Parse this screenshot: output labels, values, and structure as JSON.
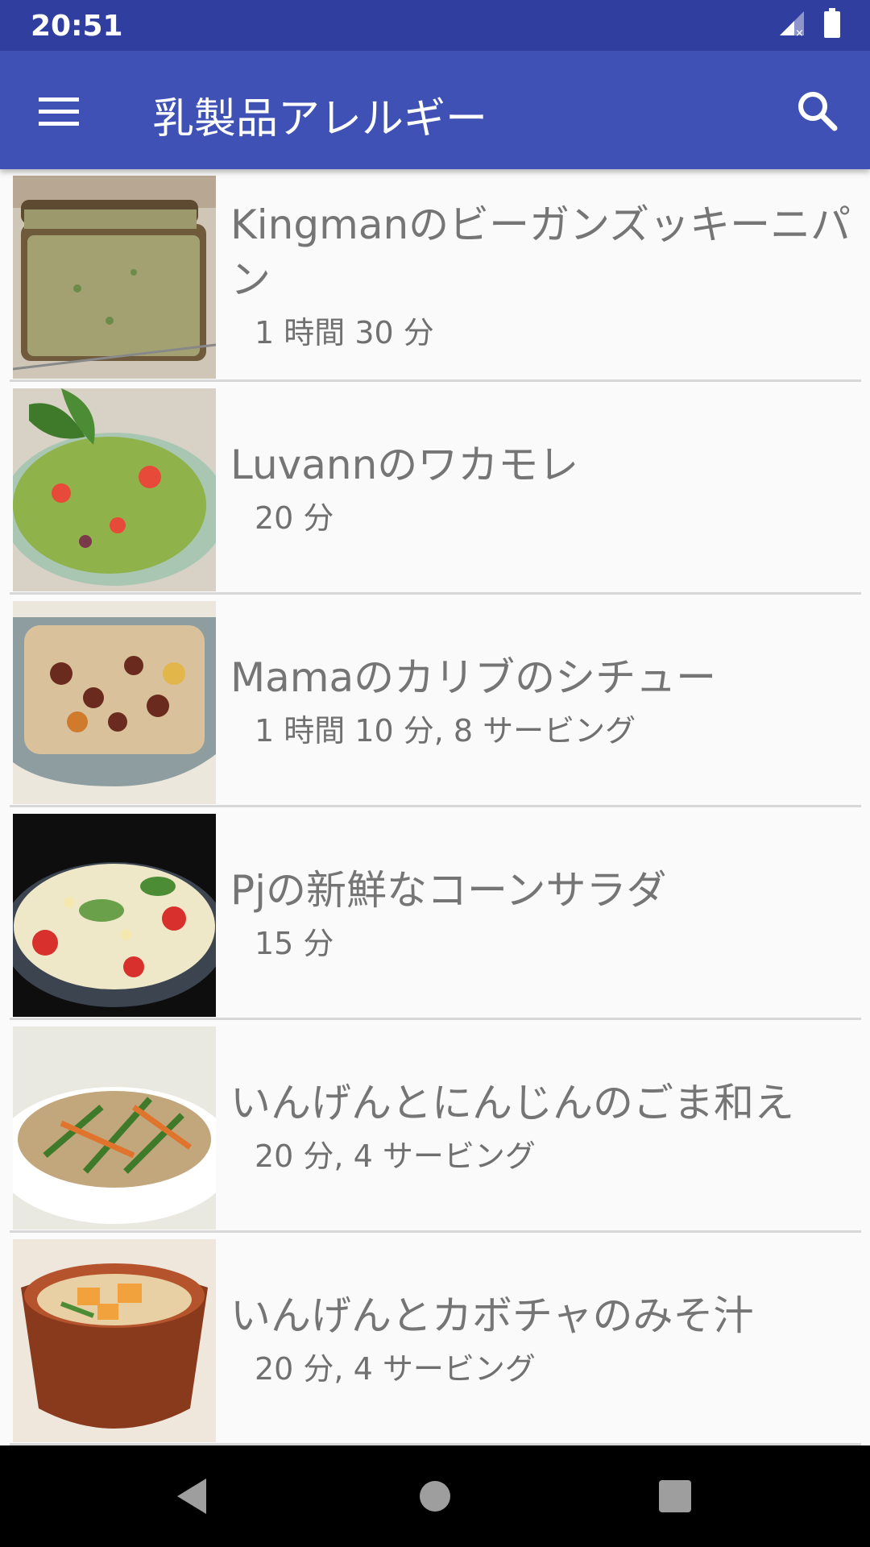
{
  "status_bar": {
    "time": "20:51",
    "icons": [
      "signal-icon",
      "battery-icon"
    ]
  },
  "app_bar": {
    "title": "乳製品アレルギー",
    "menu_icon": "menu-icon",
    "search_icon": "search-icon"
  },
  "recipes": [
    {
      "title": "Kingmanのビーガンズッキーニパン",
      "meta": "1 時間 30 分",
      "image": "zucchini-bread"
    },
    {
      "title": "Luvannのワカモレ",
      "meta": "20 分",
      "image": "guacamole"
    },
    {
      "title": "Mamaのカリブのシチュー",
      "meta": "1 時間 10 分, 8 サービング",
      "image": "caribbean-stew"
    },
    {
      "title": "Pjの新鮮なコーンサラダ",
      "meta": "15 分",
      "image": "corn-salad"
    },
    {
      "title": "いんげんとにんじんのごま和え",
      "meta": "20 分, 4 サービング",
      "image": "green-beans-carrot"
    },
    {
      "title": "いんげんとカボチャのみそ汁",
      "meta": "20 分, 4 サービング",
      "image": "miso-soup"
    }
  ],
  "nav_bar": {
    "back": "back-icon",
    "home": "home-icon",
    "recents": "recents-icon"
  },
  "colors": {
    "status_bar": "#303f9f",
    "app_bar": "#3f51b5",
    "text_primary": "#757575"
  }
}
